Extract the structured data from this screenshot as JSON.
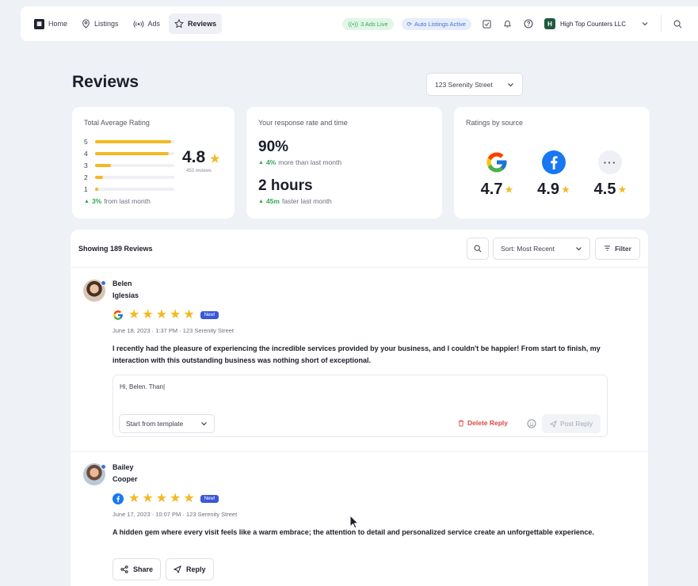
{
  "nav": {
    "items": [
      {
        "label": "Home",
        "icon": "home-logo-icon"
      },
      {
        "label": "Listings",
        "icon": "map-pin-icon"
      },
      {
        "label": "Ads",
        "icon": "broadcast-icon"
      },
      {
        "label": "Reviews",
        "icon": "star-outline-icon"
      }
    ],
    "ads_live": "3 Ads Live",
    "auto_listings": "Auto Listings Active",
    "company_initial": "H",
    "company_name": "High Top Counters LLC"
  },
  "page": {
    "title": "Reviews",
    "location": "123 Serenity Street"
  },
  "rating_card": {
    "title": "Total Average Rating",
    "rows": [
      {
        "star": "5",
        "fill": 0.96
      },
      {
        "star": "4",
        "fill": 0.93
      },
      {
        "star": "3",
        "fill": 0.2
      },
      {
        "star": "2",
        "fill": 0.1
      },
      {
        "star": "1",
        "fill": 0.04
      }
    ],
    "average": "4.8",
    "count": "453 reviews",
    "trend_value": "3%",
    "trend_text": "from last month"
  },
  "response_card": {
    "title": "Your response rate and time",
    "rate": "90%",
    "rate_trend_value": "4%",
    "rate_trend_text": "more than last month",
    "time": "2 hours",
    "time_trend_value": "45m",
    "time_trend_text": "faster last month"
  },
  "sources_card": {
    "title": "Ratings by source",
    "google": "4.7",
    "facebook": "4.9",
    "other": "4.5"
  },
  "list": {
    "showing": "Showing 189 Reviews",
    "sort": "Sort: Most Recent",
    "filter": "Filter"
  },
  "reviews": [
    {
      "first": "Belen",
      "last": "Iglesias",
      "source": "google",
      "badge": "New!",
      "meta": "June 18, 2023 · 1:37 PM · 123 Serenity Street",
      "text": "I recently had the pleasure of experiencing the incredible services provided by your business, and I couldn't be happier! From start to finish, my interaction with this outstanding business was nothing short of exceptional.",
      "reply_draft": "Hi, Belen. Than|",
      "template": "Start from template",
      "delete": "Delete Reply",
      "post": "Post Reply"
    },
    {
      "first": "Bailey",
      "last": "Cooper",
      "source": "facebook",
      "badge": "New!",
      "meta": "June 17, 2023 · 10:07 PM · 123 Serenity Street",
      "text": "A hidden gem where every visit feels like a warm embrace; the attention to detail and personalized service create an unforgettable experience.",
      "share": "Share",
      "reply": "Reply"
    }
  ],
  "colors": {
    "star": "#f3b924",
    "trend_up": "#34a853",
    "delete": "#e04545",
    "badge": "#3b58d6"
  }
}
